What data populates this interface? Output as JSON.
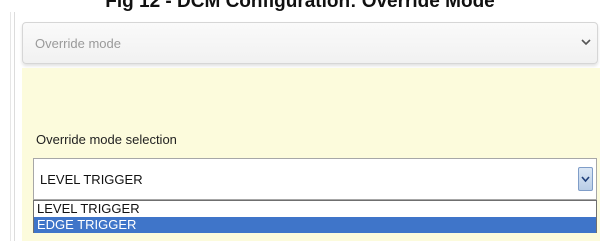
{
  "caption": "Fig 12 - DCM Configuration: Override Mode",
  "panel": {
    "title": "Override mode",
    "collapse_icon": "chevron-down-icon"
  },
  "field": {
    "label": "Override mode selection",
    "selected_value": "LEVEL TRIGGER",
    "arrow_icon": "dropdown-arrow-icon"
  },
  "dropdown": {
    "options": [
      {
        "label": "LEVEL TRIGGER",
        "highlighted": false
      },
      {
        "label": "EDGE TRIGGER",
        "highlighted": true
      }
    ]
  },
  "colors": {
    "panel_body_bg": "#fcfbdc",
    "highlight_bg": "#3f75c9"
  }
}
